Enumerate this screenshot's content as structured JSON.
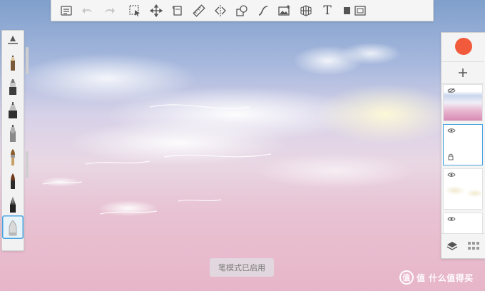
{
  "toast": {
    "text": "笔模式已启用"
  },
  "toolbar": {
    "tools": [
      {
        "name": "list-icon"
      },
      {
        "name": "undo-icon"
      },
      {
        "name": "redo-icon"
      },
      {
        "name": "selection-icon"
      },
      {
        "name": "transform-icon"
      },
      {
        "name": "canvas-icon"
      },
      {
        "name": "ruler-icon"
      },
      {
        "name": "symmetry-icon"
      },
      {
        "name": "shapes-icon"
      },
      {
        "name": "stroke-icon"
      },
      {
        "name": "image-icon"
      },
      {
        "name": "perspective-icon"
      },
      {
        "name": "text-icon"
      },
      {
        "name": "view-icon"
      }
    ],
    "text_tool_glyph": "T"
  },
  "colors": {
    "current_color": "#f25a3c",
    "accent": "#4aa3df"
  },
  "watermark": {
    "text": "值 什么值得买",
    "logo_glyph": "值"
  }
}
